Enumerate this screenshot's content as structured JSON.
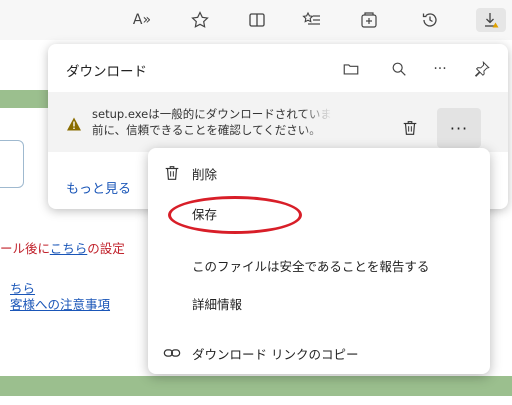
{
  "toolbar": {
    "read_aloud_label": "A»",
    "icons": [
      "read-aloud-icon",
      "favorite-icon",
      "split-screen-icon",
      "favorites-list-icon",
      "collections-icon",
      "history-icon",
      "downloads-icon"
    ]
  },
  "page": {
    "line1_red": "ール後に",
    "line1_link": "こちら",
    "line1_tail": "の設定",
    "line2_link": "ちら",
    "line3_link": "客様への注意事項"
  },
  "downloads": {
    "title": "ダウンロード",
    "item": {
      "message_line1": "setup.exeは一般的にダウンロードされていませ",
      "message_line2": "前に、信頼できることを確認してください。",
      "more_label": "···"
    },
    "see_more": "もっと見る",
    "header_more_label": "···"
  },
  "context_menu": {
    "items": [
      {
        "label": "削除",
        "icon": "trash-icon"
      },
      {
        "label": "保存",
        "icon": ""
      },
      {
        "label": "このファイルは安全であることを報告する",
        "icon": ""
      },
      {
        "label": "詳細情報",
        "icon": ""
      },
      {
        "label": "ダウンロード リンクのコピー",
        "icon": "link-icon"
      }
    ]
  },
  "colors": {
    "accent_link": "#1a56b8",
    "highlight_ellipse": "#d81e28",
    "warning": "#e0a100",
    "page_red": "#c0202a"
  }
}
